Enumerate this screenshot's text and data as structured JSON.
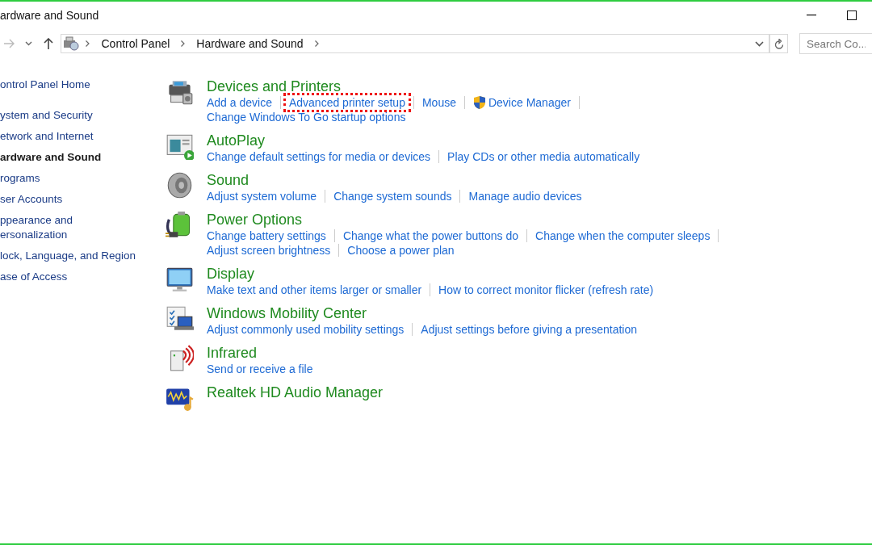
{
  "window": {
    "title": "ardware and Sound"
  },
  "address_bar": {
    "breadcrumbs": [
      "Control Panel",
      "Hardware and Sound"
    ]
  },
  "search": {
    "placeholder": "Search Co..."
  },
  "sidebar": {
    "items": [
      {
        "label": "ontrol Panel Home",
        "selected": false
      },
      {
        "label": "ystem and Security",
        "selected": false
      },
      {
        "label": "etwork and Internet",
        "selected": false
      },
      {
        "label": "ardware and Sound",
        "selected": true
      },
      {
        "label": "rograms",
        "selected": false
      },
      {
        "label": "ser Accounts",
        "selected": false
      },
      {
        "label": "ppearance and\nersonalization",
        "selected": false
      },
      {
        "label": "lock, Language, and Region",
        "selected": false
      },
      {
        "label": "ase of Access",
        "selected": false
      }
    ]
  },
  "categories": [
    {
      "title": "Devices and Printers",
      "kind": "printer",
      "lines": [
        {
          "trailing_separator": true,
          "links": [
            {
              "label": "Add a device",
              "highlighted": false,
              "shield": false
            },
            {
              "label": "Advanced printer setup",
              "highlighted": true,
              "shield": false
            },
            {
              "label": "Mouse",
              "highlighted": false,
              "shield": false
            },
            {
              "label": "Device Manager",
              "highlighted": false,
              "shield": true
            }
          ]
        },
        {
          "trailing_separator": false,
          "links": [
            {
              "label": "Change Windows To Go startup options",
              "highlighted": false,
              "shield": false
            }
          ]
        }
      ]
    },
    {
      "title": "AutoPlay",
      "kind": "autoplay",
      "lines": [
        {
          "trailing_separator": false,
          "links": [
            {
              "label": "Change default settings for media or devices",
              "highlighted": false,
              "shield": false
            },
            {
              "label": "Play CDs or other media automatically",
              "highlighted": false,
              "shield": false
            }
          ]
        }
      ]
    },
    {
      "title": "Sound",
      "kind": "speaker",
      "lines": [
        {
          "trailing_separator": false,
          "links": [
            {
              "label": "Adjust system volume",
              "highlighted": false,
              "shield": false
            },
            {
              "label": "Change system sounds",
              "highlighted": false,
              "shield": false
            },
            {
              "label": "Manage audio devices",
              "highlighted": false,
              "shield": false
            }
          ]
        }
      ]
    },
    {
      "title": "Power Options",
      "kind": "battery",
      "lines": [
        {
          "trailing_separator": true,
          "links": [
            {
              "label": "Change battery settings",
              "highlighted": false,
              "shield": false
            },
            {
              "label": "Change what the power buttons do",
              "highlighted": false,
              "shield": false
            },
            {
              "label": "Change when the computer sleeps",
              "highlighted": false,
              "shield": false
            }
          ]
        },
        {
          "trailing_separator": false,
          "links": [
            {
              "label": "Adjust screen brightness",
              "highlighted": false,
              "shield": false
            },
            {
              "label": "Choose a power plan",
              "highlighted": false,
              "shield": false
            }
          ]
        }
      ]
    },
    {
      "title": "Display",
      "kind": "monitor",
      "lines": [
        {
          "trailing_separator": false,
          "links": [
            {
              "label": "Make text and other items larger or smaller",
              "highlighted": false,
              "shield": false
            },
            {
              "label": "How to correct monitor flicker (refresh rate)",
              "highlighted": false,
              "shield": false
            }
          ]
        }
      ]
    },
    {
      "title": "Windows Mobility Center",
      "kind": "mobility",
      "lines": [
        {
          "trailing_separator": false,
          "links": [
            {
              "label": "Adjust commonly used mobility settings",
              "highlighted": false,
              "shield": false
            },
            {
              "label": "Adjust settings before giving a presentation",
              "highlighted": false,
              "shield": false
            }
          ]
        }
      ]
    },
    {
      "title": "Infrared",
      "kind": "infrared",
      "lines": [
        {
          "trailing_separator": false,
          "links": [
            {
              "label": "Send or receive a file",
              "highlighted": false,
              "shield": false
            }
          ]
        }
      ]
    },
    {
      "title": "Realtek HD Audio Manager",
      "kind": "audio"
    }
  ]
}
